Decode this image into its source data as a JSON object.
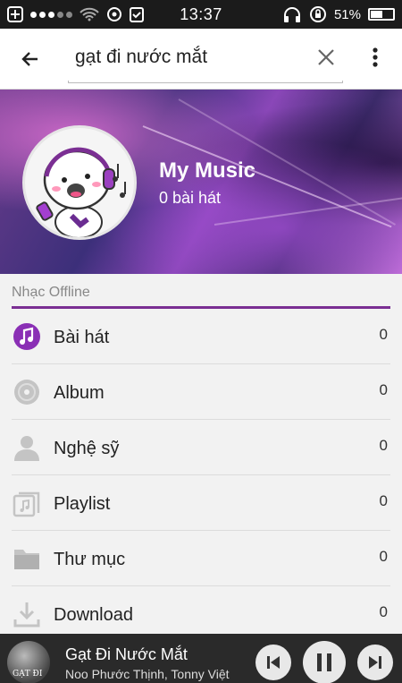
{
  "statusbar": {
    "time": "13:37",
    "battery": "51%"
  },
  "search": {
    "query": "gạt đi nước mắt"
  },
  "banner": {
    "title": "My Music",
    "subtitle": "0 bài hát"
  },
  "section": {
    "label": "Nhạc Offline"
  },
  "list": [
    {
      "label": "Bài hát",
      "count": "0",
      "icon": "music-note-icon"
    },
    {
      "label": "Album",
      "count": "0",
      "icon": "disc-icon"
    },
    {
      "label": "Nghệ sỹ",
      "count": "0",
      "icon": "artist-icon"
    },
    {
      "label": "Playlist",
      "count": "0",
      "icon": "playlist-icon"
    },
    {
      "label": "Thư mục",
      "count": "0",
      "icon": "folder-icon"
    },
    {
      "label": "Download",
      "count": "0",
      "icon": "download-icon"
    }
  ],
  "player": {
    "title": "Gạt Đi Nước Mắt",
    "artist": "Noo Phước Thịnh, Tonny Việt",
    "thumb_text": "GẠT ĐI"
  },
  "colors": {
    "accent": "#7b2f93",
    "list_bg": "#f2f2f2",
    "player_bg": "#2a2a2a"
  }
}
